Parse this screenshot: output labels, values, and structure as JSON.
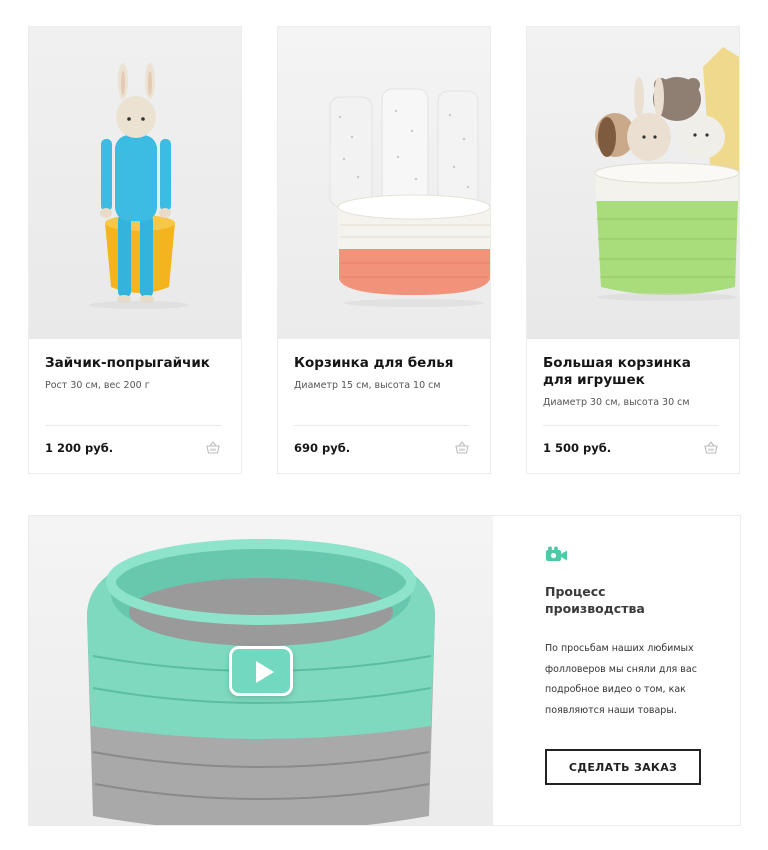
{
  "products": [
    {
      "title": "Зайчик-попрыгайчик",
      "subtitle": "Рост 30 см, вес 200 г",
      "price": "1 200 руб.",
      "image": "crochet-bunny-photo",
      "cart_icon": "basket-icon"
    },
    {
      "title": "Корзинка для белья",
      "subtitle": "Диаметр 15 см, высота 10 см",
      "price": "690 руб.",
      "image": "laundry-basket-photo",
      "cart_icon": "basket-icon"
    },
    {
      "title_line1": "Большая корзинка",
      "title_line2": "для игрушек",
      "subtitle": "Диаметр 30 см, высота 30 см",
      "price": "1 500 руб.",
      "image": "toy-basket-photo",
      "cart_icon": "basket-icon"
    }
  ],
  "video": {
    "icon": "video-camera-icon",
    "title_line1": "Процесс",
    "title_line2": "производства",
    "text_line1": "По просьбам наших любимых",
    "text_line2": "фолловеров мы сняли для вас",
    "text_line3": "подробное видео о том, как",
    "text_line4": "появляются наши товары.",
    "button_label": "СДЕЛАТЬ ЗАКАЗ",
    "play_icon": "play-icon"
  },
  "colors": {
    "accent": "#72d8c0",
    "text": "#1c1c1c",
    "border": "#ececec"
  }
}
